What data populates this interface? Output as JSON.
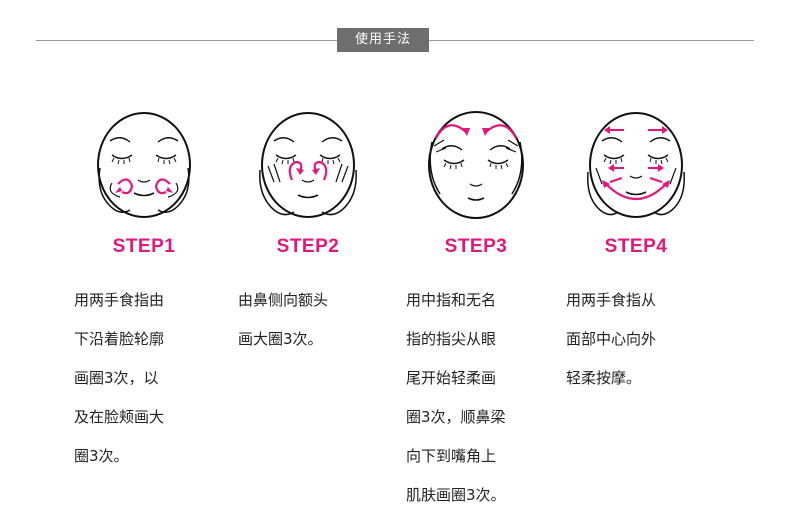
{
  "header": {
    "title": "使用手法"
  },
  "steps": [
    {
      "label": "STEP1",
      "lines": [
        "用两手食指由",
        "下沿着脸轮廓",
        "画圈3次，以",
        "及在脸颊画大",
        "圈3次。"
      ]
    },
    {
      "label": "STEP2",
      "lines": [
        "由鼻侧向额头",
        "画大圈3次。"
      ]
    },
    {
      "label": "STEP3",
      "lines": [
        "用中指和无名",
        "指的指尖从眼",
        "尾开始轻柔画",
        "圈3次，顺鼻梁",
        "向下到嘴角上",
        "肌肤画圈3次。"
      ]
    },
    {
      "label": "STEP4",
      "lines": [
        "用两手食指从",
        "面部中心向外",
        "轻柔按摩。"
      ]
    }
  ],
  "colors": {
    "accent": "#e5157a",
    "header_bg": "#6e6e6e",
    "rule": "#9a9a9a"
  }
}
